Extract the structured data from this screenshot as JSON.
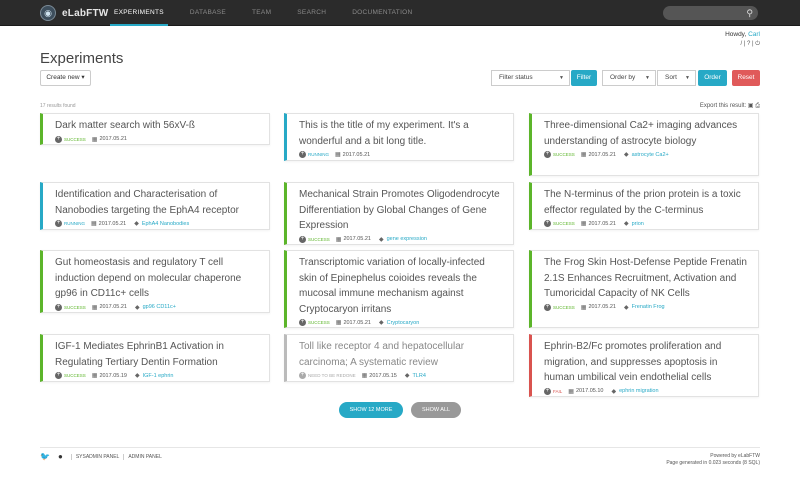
{
  "app": {
    "name": "eLabFTW"
  },
  "nav": {
    "items": [
      {
        "label": "EXPERIMENTS"
      },
      {
        "label": "DATABASE"
      },
      {
        "label": "TEAM"
      },
      {
        "label": "SEARCH"
      },
      {
        "label": "DOCUMENTATION"
      }
    ],
    "active": "EXPERIMENTS"
  },
  "user": {
    "greeting": "Howdy,",
    "name": "Carl",
    "links": "/ | ? | ⏻"
  },
  "page": {
    "title": "Experiments"
  },
  "toolbar": {
    "create_label": "Create new ▾",
    "filter_status": "Filter status",
    "filter_button": "Filter",
    "order_by": "Order by",
    "sort": "Sort",
    "order_button": "Order",
    "reset_button": "Reset"
  },
  "results": {
    "count_text": "17 results found",
    "export_label": "Export this result:"
  },
  "experiments": [
    {
      "title": "Dark matter search with 56xV-ß",
      "status": "SUCCESS",
      "date": "2017.05.21",
      "tag": ""
    },
    {
      "title": "This is the title of my experiment. It's a wonderful and a bit long title.",
      "status": "RUNNING",
      "date": "2017.05.21",
      "tag": ""
    },
    {
      "title": "Three-dimensional Ca2+ imaging advances understanding of astrocyte biology",
      "status": "SUCCESS",
      "date": "2017.05.21",
      "tag": "astrocyte Ca2+"
    },
    {
      "title": "Identification and Characterisation of Nanobodies targeting the EphA4 receptor",
      "status": "RUNNING",
      "date": "2017.05.21",
      "tag": "EphA4 Nanobodies"
    },
    {
      "title": "Mechanical Strain Promotes Oligodendrocyte Differentiation by Global Changes of Gene Expression",
      "status": "SUCCESS",
      "date": "2017.05.21",
      "tag": "gene expression"
    },
    {
      "title": "The N-terminus of the prion protein is a toxic effector regulated by the C-terminus",
      "status": "SUCCESS",
      "date": "2017.05.21",
      "tag": "prion"
    },
    {
      "title": "Gut homeostasis and regulatory T cell induction depend on molecular chaperone gp96 in CD11c+ cells",
      "status": "SUCCESS",
      "date": "2017.05.21",
      "tag": "gp96 CD11c+"
    },
    {
      "title": "Transcriptomic variation of locally-infected skin of Epinephelus coioides reveals the mucosal immune mechanism against Cryptocaryon irritans",
      "status": "SUCCESS",
      "date": "2017.05.21",
      "tag": "Cryptocaryon"
    },
    {
      "title": "The Frog Skin Host-Defense Peptide Frenatin 2.1S Enhances Recruitment, Activation and Tumoricidal Capacity of NK Cells",
      "status": "SUCCESS",
      "date": "2017.05.21",
      "tag": "Frenatin Frog"
    },
    {
      "title": "IGF-1 Mediates EphrinB1 Activation in Regulating Tertiary Dentin Formation",
      "status": "SUCCESS",
      "date": "2017.05.19",
      "tag": "IGF-1 ephrin"
    },
    {
      "title": "Toll like receptor 4 and hepatocellular carcinoma; A systematic review",
      "status": "NEED TO BE REDONE",
      "date": "2017.05.15",
      "tag": "TLR4"
    },
    {
      "title": "Ephrin-B2/Fc promotes proliferation and migration, and suppresses apoptosis in human umbilical vein endothelial cells",
      "status": "FAIL",
      "date": "2017.05.10",
      "tag": "ephrin migration"
    }
  ],
  "buttons": {
    "show_more": "SHOW 12 MORE",
    "show_all": "SHOW ALL"
  },
  "footer": {
    "links": [
      "SYSADMIN PANEL",
      "ADMIN PANEL"
    ],
    "powered": "Powered by eLabFTW",
    "generated": "Page generated in 0.023 seconds (8 SQL)"
  },
  "colors": {
    "accent": "#27a9c6",
    "success": "#5cb52a",
    "fail": "#d9534f",
    "redo": "#bbbbbb"
  }
}
